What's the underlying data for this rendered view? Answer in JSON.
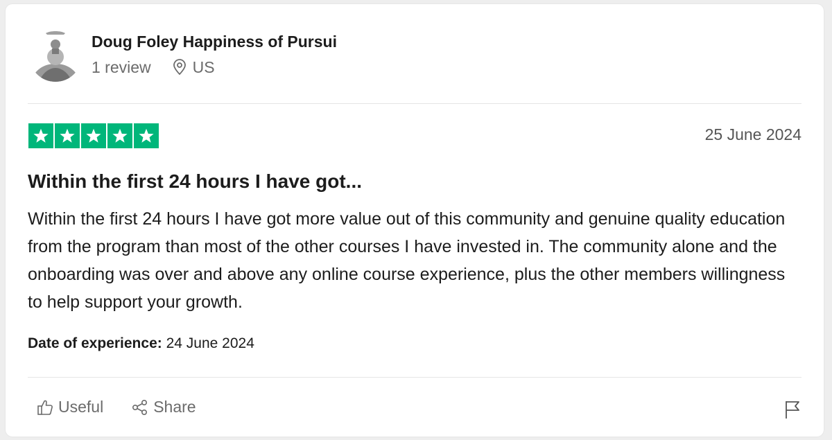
{
  "reviewer": {
    "name": "Doug Foley Happiness of Pursui",
    "review_count": "1 review",
    "country": "US"
  },
  "review": {
    "rating": 5,
    "max_rating": 5,
    "date": "25 June 2024",
    "title": "Within the first 24 hours I have got...",
    "body": "Within the first 24 hours I have got more value out of this community and genuine quality education from the program than most of the other courses I have invested in. The community alone and the onboarding was over and above any online course experience, plus the other members willingness to help support your growth.",
    "experience_label": "Date of experience:",
    "experience_date": "24 June 2024"
  },
  "actions": {
    "useful_label": "Useful",
    "share_label": "Share"
  },
  "colors": {
    "star_green": "#00b67a",
    "muted_text": "#6b6b6b"
  },
  "icons": [
    "avatar-photo",
    "location-pin-icon",
    "star-icon",
    "thumbs-up-icon",
    "share-icon",
    "flag-icon"
  ]
}
